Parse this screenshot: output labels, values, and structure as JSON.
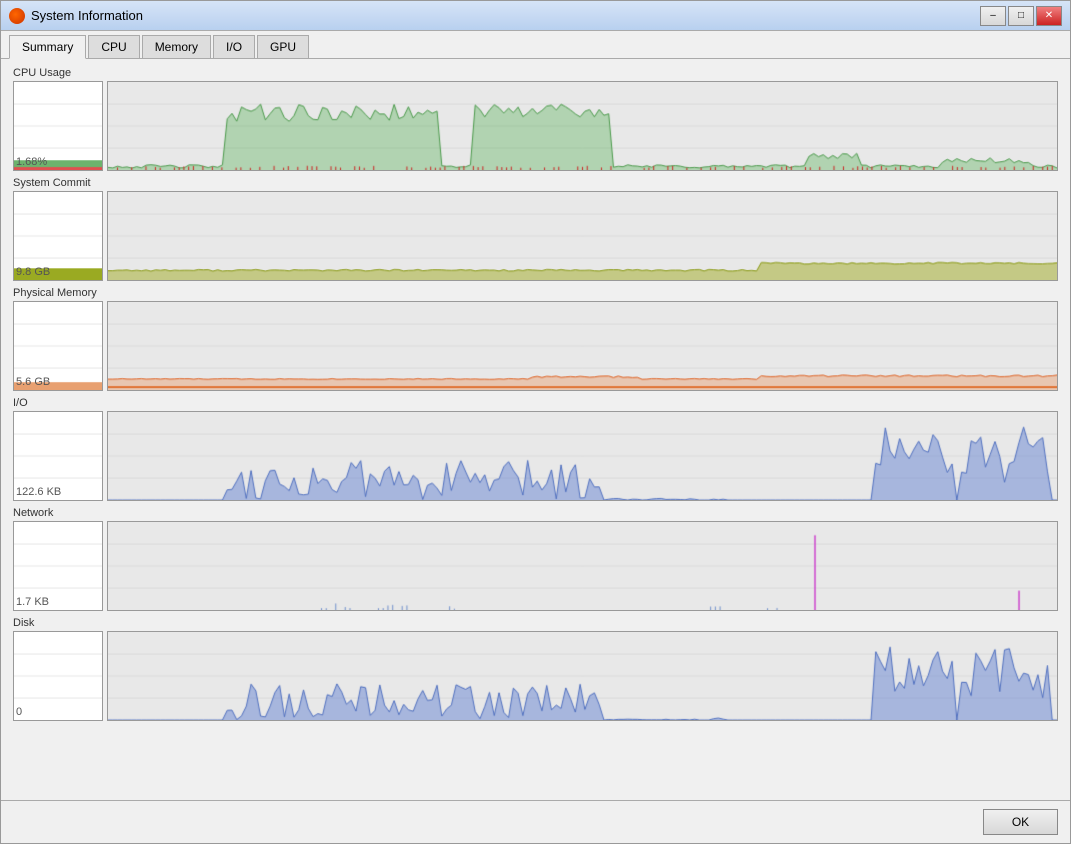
{
  "window": {
    "title": "System Information",
    "controls": {
      "minimize": "–",
      "maximize": "□",
      "close": "✕"
    }
  },
  "tabs": [
    {
      "label": "Summary",
      "active": true
    },
    {
      "label": "CPU",
      "active": false
    },
    {
      "label": "Memory",
      "active": false
    },
    {
      "label": "I/O",
      "active": false
    },
    {
      "label": "GPU",
      "active": false
    }
  ],
  "sections": [
    {
      "id": "cpu-usage",
      "title": "CPU Usage",
      "value": "1.68%",
      "color": "#6db36d",
      "type": "cpu"
    },
    {
      "id": "system-commit",
      "title": "System Commit",
      "value": "9.8 GB",
      "color": "#9aaa22",
      "type": "commit"
    },
    {
      "id": "physical-memory",
      "title": "Physical Memory",
      "value": "5.6 GB",
      "color": "#e8a070",
      "type": "memory"
    },
    {
      "id": "io",
      "title": "I/O",
      "value": "122.6  KB",
      "color": "#7090d0",
      "type": "io"
    },
    {
      "id": "network",
      "title": "Network",
      "value": "1.7  KB",
      "color": "#aa44cc",
      "type": "network"
    },
    {
      "id": "disk",
      "title": "Disk",
      "value": "0",
      "color": "#7090d0",
      "type": "disk"
    }
  ],
  "footer": {
    "ok_label": "OK"
  }
}
